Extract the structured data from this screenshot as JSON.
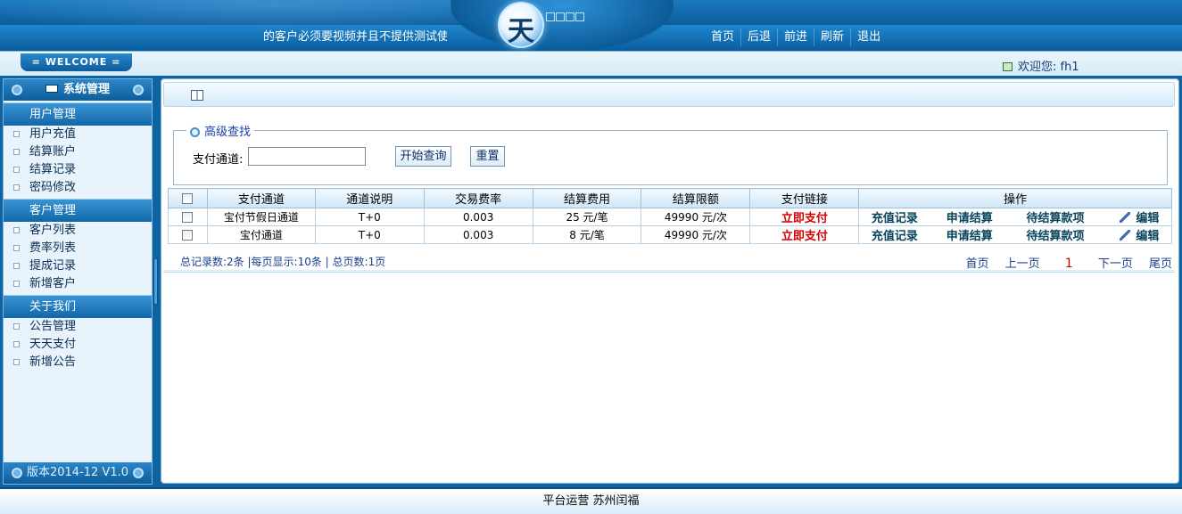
{
  "header": {
    "marquee": "的客户必须要视频并且不提供测试使",
    "logo_char": "天",
    "nav": [
      "首页",
      "后退",
      "前进",
      "刷新",
      "退出"
    ]
  },
  "welcome": {
    "badge": "= WELCOME =",
    "greeting": "欢迎您: fh1"
  },
  "sidebar": {
    "title": "系统管理",
    "groups": [
      {
        "label": "用户管理",
        "items": [
          "用户充值",
          "结算账户",
          "结算记录",
          "密码修改"
        ]
      },
      {
        "label": "客户管理",
        "items": [
          "客户列表",
          "费率列表",
          "提成记录",
          "新增客户"
        ]
      },
      {
        "label": "关于我们",
        "items": [
          "公告管理",
          "天天支付",
          "新增公告"
        ]
      }
    ],
    "version": "版本2014-12 V1.0"
  },
  "search": {
    "legend": "高级查找",
    "field_label": "支付通道:",
    "field_value": "",
    "query_button": "开始查询",
    "reset_button": "重置"
  },
  "table": {
    "headers": [
      "支付通道",
      "通道说明",
      "交易费率",
      "结算费用",
      "结算限额",
      "支付链接",
      "操作"
    ],
    "rows": [
      {
        "channel": "宝付节假日通道",
        "desc": "T+0",
        "rate": "0.003",
        "fee": "25 元/笔",
        "limit": "49990 元/次",
        "pay": "立即支付",
        "ops": [
          "充值记录",
          "申请结算",
          "待结算款项",
          "编辑"
        ]
      },
      {
        "channel": "宝付通道",
        "desc": "T+0",
        "rate": "0.003",
        "fee": "8 元/笔",
        "limit": "49990 元/次",
        "pay": "立即支付",
        "ops": [
          "充值记录",
          "申请结算",
          "待结算款项",
          "编辑"
        ]
      }
    ]
  },
  "pager": {
    "info": "总记录数:2条 |每页显示:10条 | 总页数:1页",
    "first": "首页",
    "prev": "上一页",
    "current": "1",
    "next": "下一页",
    "last": "尾页"
  },
  "footer": {
    "text": "平台运营 苏州闰福"
  }
}
